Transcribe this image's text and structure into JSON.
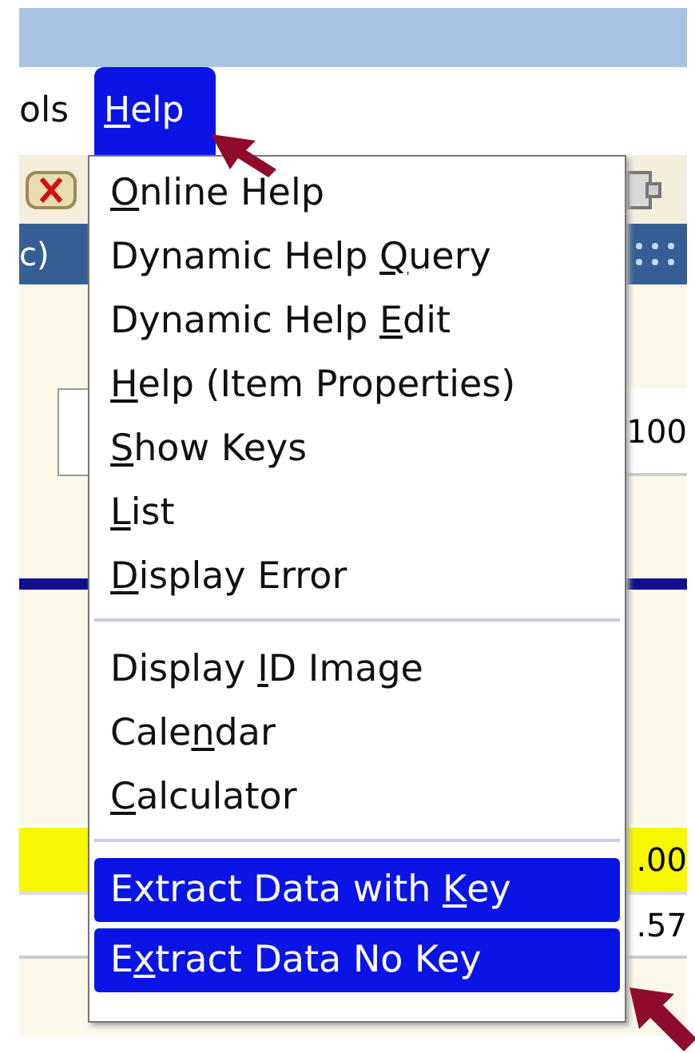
{
  "menubar": [
    {
      "label": "ols",
      "selected": false
    },
    {
      "key": "H",
      "post": "elp",
      "selected": true
    }
  ],
  "background": {
    "title_fragment": "c)",
    "field_fragment": "100",
    "yellow_cell": ".00",
    "white_cell": ".57"
  },
  "help_menu": {
    "groups": [
      [
        {
          "key": "O",
          "post": "nline Help",
          "selected": false
        },
        {
          "pre": "Dynamic Help ",
          "key": "Q",
          "post": "uery",
          "selected": false
        },
        {
          "pre": "Dynamic Help ",
          "key": "E",
          "post": "dit",
          "selected": false
        },
        {
          "key": "H",
          "post": "elp (Item Properties)",
          "selected": false
        },
        {
          "key": "S",
          "post": "how Keys",
          "selected": false
        },
        {
          "key": "L",
          "post": "ist",
          "selected": false
        },
        {
          "key": "D",
          "post": "isplay Error",
          "selected": false
        }
      ],
      [
        {
          "pre": "Display ",
          "key": "I",
          "post": "D Image",
          "selected": false
        },
        {
          "pre": "Cale",
          "key": "n",
          "post": "dar",
          "selected": false
        },
        {
          "key": "C",
          "post": "alculator",
          "selected": false
        }
      ],
      [
        {
          "pre": "Extract Data with ",
          "key": "K",
          "post": "ey",
          "selected": true
        },
        {
          "pre": "E",
          "key": "x",
          "post": "tract Data No Key",
          "selected": true
        }
      ]
    ]
  }
}
